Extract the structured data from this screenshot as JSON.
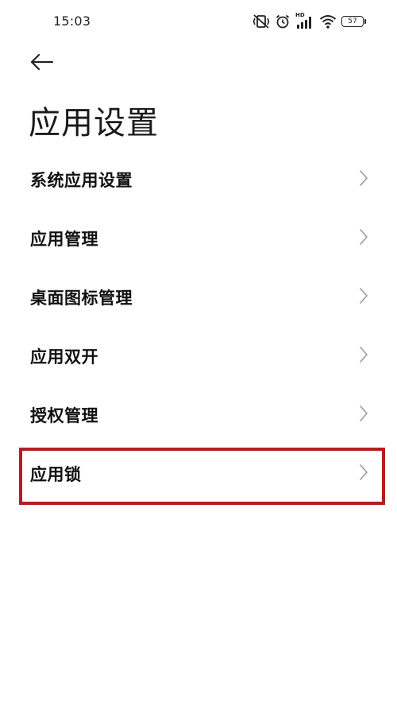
{
  "status_bar": {
    "time": "15:03",
    "icons": [
      "vibrate-off-icon",
      "alarm-icon",
      "hd-signal-icon",
      "wifi-icon",
      "battery-icon"
    ],
    "hd_label": "HD",
    "battery_level": "57"
  },
  "header": {
    "back_icon": "back-arrow-icon",
    "title": "应用设置"
  },
  "settings": {
    "items": [
      {
        "label": "系统应用设置",
        "icon": "chevron-right-icon"
      },
      {
        "label": "应用管理",
        "icon": "chevron-right-icon"
      },
      {
        "label": "桌面图标管理",
        "icon": "chevron-right-icon"
      },
      {
        "label": "应用双开",
        "icon": "chevron-right-icon"
      },
      {
        "label": "授权管理",
        "icon": "chevron-right-icon"
      },
      {
        "label": "应用锁",
        "icon": "chevron-right-icon"
      }
    ]
  },
  "highlight": {
    "target": "应用锁",
    "color": "#b21f1f"
  },
  "colors": {
    "background": "#ffffff",
    "text": "#111111",
    "chevron": "#9a9a9a"
  }
}
